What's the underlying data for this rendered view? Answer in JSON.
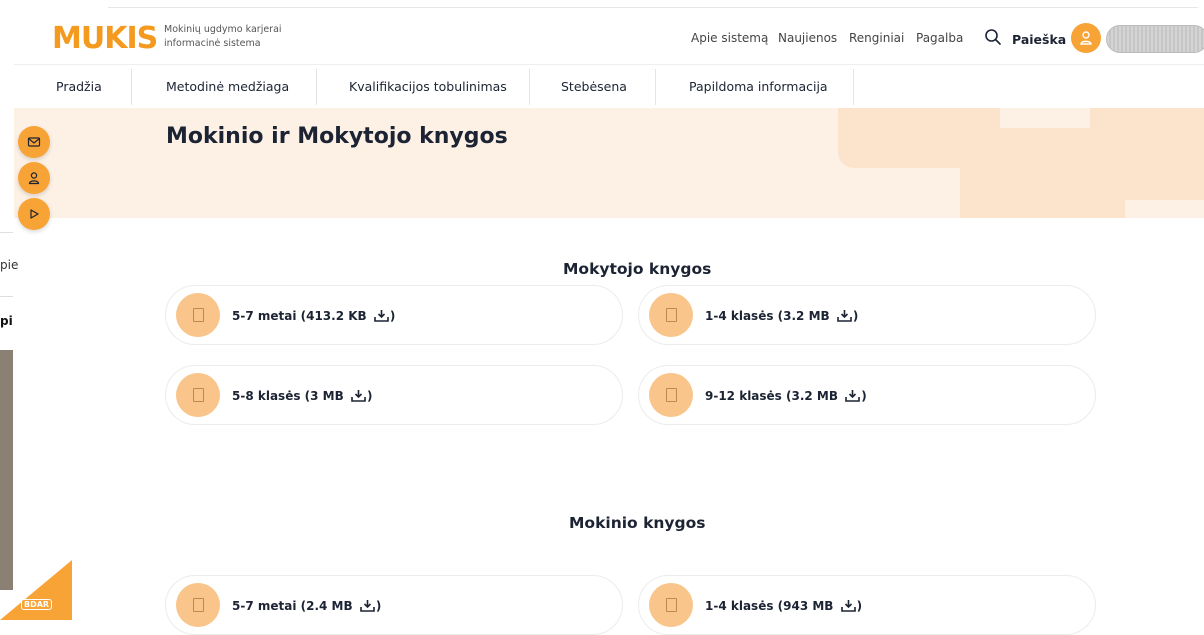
{
  "header": {
    "logo_text": "MUKIS",
    "tagline": "Mokinių ugdymo karjerai informacinė sistema",
    "top_links": [
      "Apie sistemą",
      "Naujienos",
      "Renginiai",
      "Pagalba"
    ],
    "search_label": "Paieška"
  },
  "main_nav": {
    "items": [
      "Pradžia",
      "Metodinė medžiaga",
      "Kvalifikacijos tobulinimas",
      "Stebėsena",
      "Papildoma informacija"
    ]
  },
  "hero": {
    "title": "Mokinio ir Mokytojo knygos"
  },
  "background_fragments": {
    "text1": "pie",
    "text2": "pi"
  },
  "sections": [
    {
      "title": "Mokytojo knygos",
      "cards": [
        {
          "label": "5-7 metai (413.2 KB ",
          "tail": ")"
        },
        {
          "label": "1-4 klasės (3.2 MB ",
          "tail": ")"
        },
        {
          "label": "5-8 klasės (3 MB ",
          "tail": ")"
        },
        {
          "label": "9-12 klasės (3.2 MB ",
          "tail": ")"
        }
      ]
    },
    {
      "title": "Mokinio knygos",
      "cards": [
        {
          "label": "5-7 metai (2.4 MB ",
          "tail": ")"
        },
        {
          "label": "1-4 klasės (943 MB ",
          "tail": ")"
        }
      ]
    }
  ],
  "side_buttons": [
    "mail-icon",
    "user-icon",
    "play-icon"
  ],
  "bdar": {
    "label": "BDAR"
  },
  "colors": {
    "accent": "#f8a335",
    "card_circle": "#f9c58a",
    "hero_bg": "#fdf1e6",
    "text": "#1c2333"
  }
}
